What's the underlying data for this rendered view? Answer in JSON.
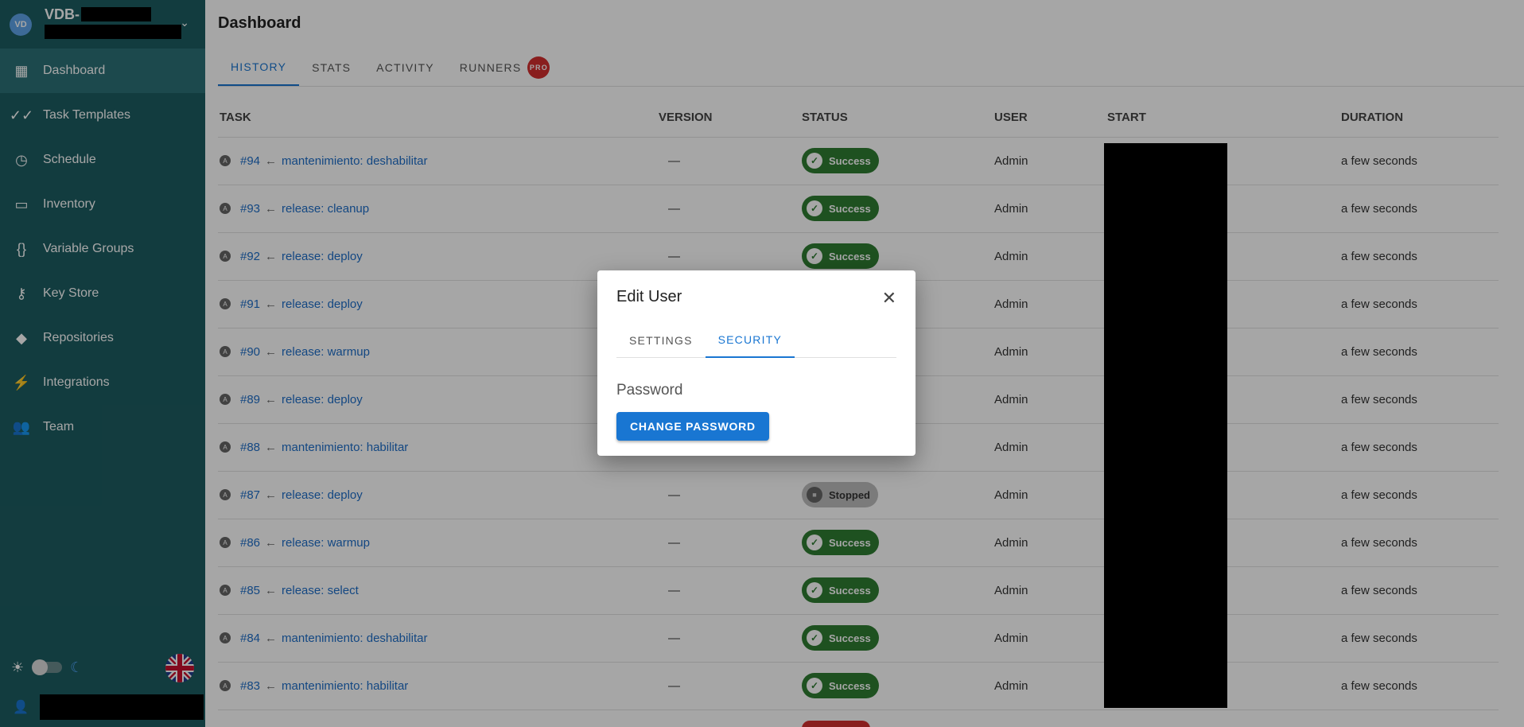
{
  "sidebar": {
    "avatar": "VD",
    "project_name": "VDB-",
    "items": [
      {
        "label": "Dashboard",
        "icon": "▦"
      },
      {
        "label": "Task Templates",
        "icon": "✓✓"
      },
      {
        "label": "Schedule",
        "icon": "◷"
      },
      {
        "label": "Inventory",
        "icon": "▭"
      },
      {
        "label": "Variable Groups",
        "icon": "{}"
      },
      {
        "label": "Key Store",
        "icon": "⚷"
      },
      {
        "label": "Repositories",
        "icon": "◆"
      },
      {
        "label": "Integrations",
        "icon": "⚡"
      },
      {
        "label": "Team",
        "icon": "👥"
      }
    ],
    "theme_icons": {
      "light": "☀",
      "dark": "☾"
    },
    "user_icon": "👤"
  },
  "page": {
    "title": "Dashboard",
    "tabs": [
      "HISTORY",
      "STATS",
      "ACTIVITY",
      "RUNNERS"
    ],
    "pro_badge": "PRO"
  },
  "table": {
    "headers": [
      "TASK",
      "VERSION",
      "STATUS",
      "USER",
      "START",
      "DURATION"
    ],
    "rows": [
      {
        "id": "#94",
        "template": "mantenimiento: deshabilitar",
        "version": "—",
        "status": "Success",
        "user": "Admin",
        "duration": "a few seconds"
      },
      {
        "id": "#93",
        "template": "release: cleanup",
        "version": "—",
        "status": "Success",
        "user": "Admin",
        "duration": "a few seconds"
      },
      {
        "id": "#92",
        "template": "release: deploy",
        "version": "—",
        "status": "Success",
        "user": "Admin",
        "duration": "a few seconds"
      },
      {
        "id": "#91",
        "template": "release: deploy",
        "version": "",
        "status": "",
        "user": "Admin",
        "duration": "a few seconds"
      },
      {
        "id": "#90",
        "template": "release: warmup",
        "version": "",
        "status": "",
        "user": "Admin",
        "duration": "a few seconds"
      },
      {
        "id": "#89",
        "template": "release: deploy",
        "version": "",
        "status": "",
        "user": "Admin",
        "duration": "a few seconds"
      },
      {
        "id": "#88",
        "template": "mantenimiento: habilitar",
        "version": "",
        "status": "",
        "user": "Admin",
        "duration": "a few seconds"
      },
      {
        "id": "#87",
        "template": "release: deploy",
        "version": "—",
        "status": "Stopped",
        "user": "Admin",
        "duration": "a few seconds"
      },
      {
        "id": "#86",
        "template": "release: warmup",
        "version": "—",
        "status": "Success",
        "user": "Admin",
        "duration": "a few seconds"
      },
      {
        "id": "#85",
        "template": "release: select",
        "version": "—",
        "status": "Success",
        "user": "Admin",
        "duration": "a few seconds"
      },
      {
        "id": "#84",
        "template": "mantenimiento: deshabilitar",
        "version": "—",
        "status": "Success",
        "user": "Admin",
        "duration": "a few seconds"
      },
      {
        "id": "#83",
        "template": "mantenimiento: habilitar",
        "version": "—",
        "status": "Success",
        "user": "Admin",
        "duration": "a few seconds"
      }
    ]
  },
  "dialog": {
    "title": "Edit User",
    "tabs": [
      "SETTINGS",
      "SECURITY"
    ],
    "active_tab": "SECURITY",
    "field_label": "Password",
    "button_label": "CHANGE PASSWORD"
  },
  "colors": {
    "sidebar_bg": "#1d5c61",
    "accent": "#1976d2",
    "success": "#2e7d32",
    "pro": "#d32f2f"
  }
}
